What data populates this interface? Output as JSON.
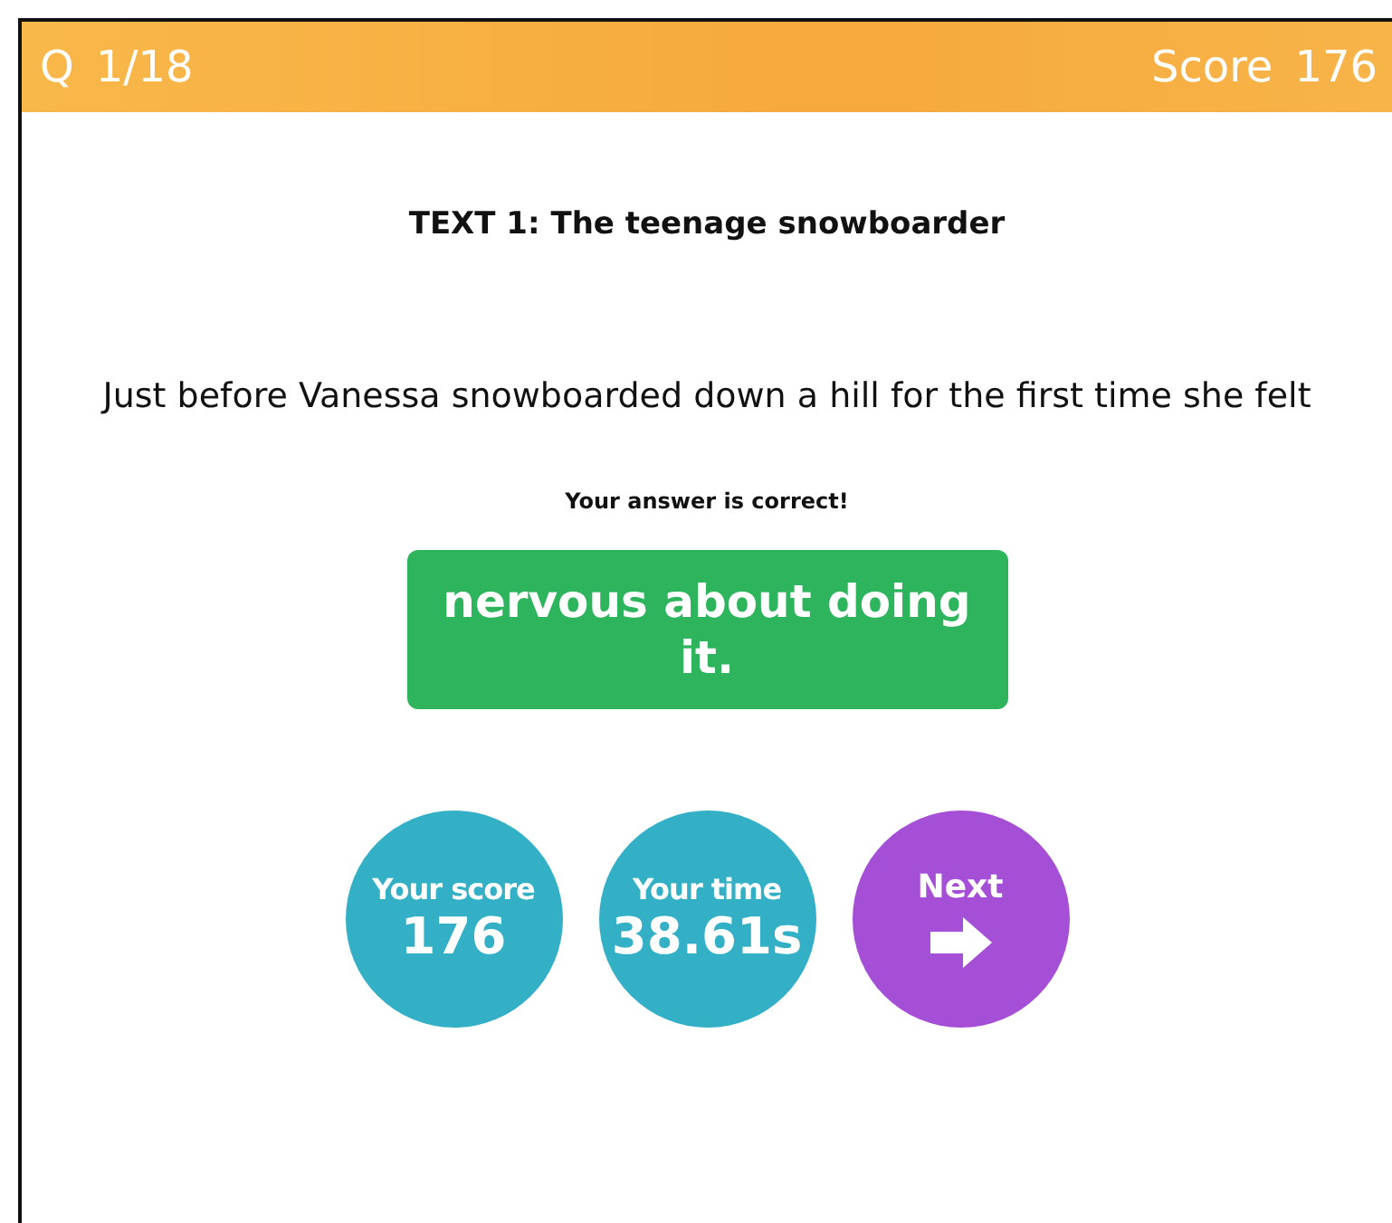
{
  "header": {
    "question_label": "Q",
    "question_counter": "1/18",
    "score_label": "Score",
    "score_value": "176"
  },
  "text_title": "TEXT 1: The teenage snowboarder",
  "question": "Just before Vanessa snowboarded down a hill for the first time she felt",
  "feedback": "Your answer is correct!",
  "answer": {
    "text": "nervous about doing it.",
    "correct": true
  },
  "stats": [
    {
      "kind": "stat",
      "label": "Your score",
      "value": "176"
    },
    {
      "kind": "stat",
      "label": "Your time",
      "value": "38.61s"
    },
    {
      "kind": "next",
      "label": "Next"
    }
  ]
}
